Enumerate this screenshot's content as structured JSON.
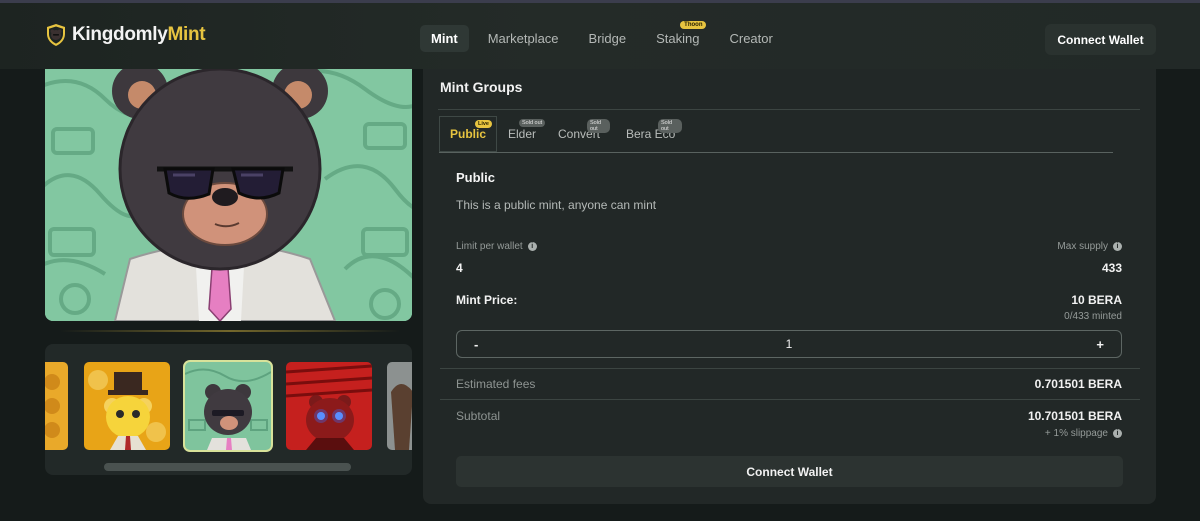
{
  "header": {
    "logo": {
      "part1": "Kingdomly",
      "part2": "Mint"
    },
    "nav": [
      {
        "label": "Mint",
        "active": true
      },
      {
        "label": "Marketplace"
      },
      {
        "label": "Bridge"
      },
      {
        "label": "Staking",
        "badge": "Thoon"
      },
      {
        "label": "Creator"
      }
    ],
    "connect_label": "Connect Wallet"
  },
  "gallery": {
    "thumbs": [
      {
        "name": "yellow-partial",
        "bg": "#e9a92a"
      },
      {
        "name": "yellow-bear-tophat",
        "bg": "#e8a417"
      },
      {
        "name": "dark-bear-sunglasses",
        "bg": "#7fc49d",
        "selected": true
      },
      {
        "name": "red-bear-glow",
        "bg": "#c5201e"
      },
      {
        "name": "grey-partial",
        "bg": "#8c9190"
      }
    ]
  },
  "mint": {
    "section_title": "Mint Groups",
    "tabs": [
      {
        "label": "Public",
        "badge": "Live",
        "active": true
      },
      {
        "label": "Elder",
        "badge": "Sold out"
      },
      {
        "label": "Convert",
        "badge": "Sold out"
      },
      {
        "label": "Bera Eco",
        "badge": "Sold out"
      }
    ],
    "group_title": "Public",
    "group_desc": "This is a public mint, anyone can mint",
    "limit_label": "Limit per wallet",
    "limit_value": "4",
    "max_supply_label": "Max supply",
    "max_supply_value": "433",
    "price_label": "Mint Price:",
    "price_value": "10 BERA",
    "minted_text": "0/433 minted",
    "stepper": {
      "minus": "-",
      "value": "1",
      "plus": "+"
    },
    "fees_label": "Estimated fees",
    "fees_value": "0.701501 BERA",
    "subtotal_label": "Subtotal",
    "subtotal_value": "10.701501 BERA",
    "slippage_text": "+ 1% slippage",
    "connect_label": "Connect Wallet"
  },
  "colors": {
    "accent": "#e7c440",
    "background": "#151b1a",
    "panel": "#222827"
  }
}
